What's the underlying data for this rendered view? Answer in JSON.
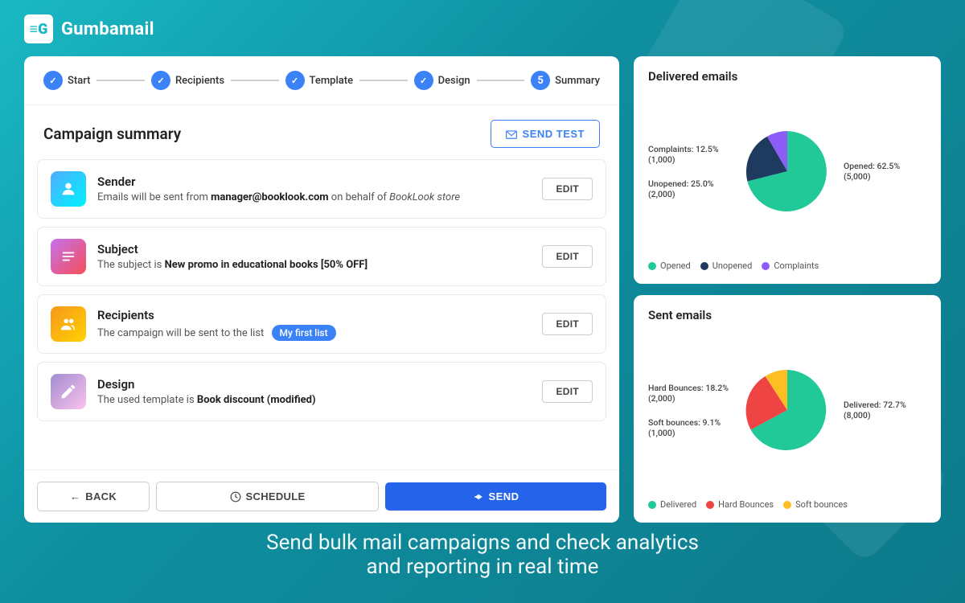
{
  "app": {
    "logo_text": "Gumbamail",
    "logo_icon": "≡G"
  },
  "tagline": {
    "line1": "Send bulk mail campaigns and check analytics",
    "line2": "and reporting in real time"
  },
  "stepper": {
    "steps": [
      {
        "id": "start",
        "label": "Start",
        "type": "check"
      },
      {
        "id": "recipients",
        "label": "Recipients",
        "type": "check"
      },
      {
        "id": "template",
        "label": "Template",
        "type": "check"
      },
      {
        "id": "design",
        "label": "Design",
        "type": "check"
      },
      {
        "id": "summary",
        "label": "Summary",
        "type": "number",
        "number": "5",
        "active": true
      }
    ]
  },
  "campaign": {
    "title": "Campaign summary",
    "send_test_label": "SEND TEST",
    "items": [
      {
        "id": "sender",
        "icon_type": "sender",
        "title": "Sender",
        "description_html": "Emails will be sent from <strong>manager@booklook.com</strong> on behalf of <em>BookLook store</em>",
        "edit_label": "EDIT"
      },
      {
        "id": "subject",
        "icon_type": "subject",
        "title": "Subject",
        "description_html": "The subject is <strong>New promo in educational books [50% OFF]</strong>",
        "edit_label": "EDIT"
      },
      {
        "id": "recipients",
        "icon_type": "recipients",
        "title": "Recipients",
        "description_text": "The campaign will be sent to the list",
        "badge": "My first list",
        "edit_label": "EDIT"
      },
      {
        "id": "design",
        "icon_type": "design",
        "title": "Design",
        "description_html": "The used template is <strong>Book discount (modified)</strong>",
        "edit_label": "EDIT"
      }
    ]
  },
  "footer": {
    "back_label": "BACK",
    "schedule_label": "SCHEDULE",
    "send_label": "SEND"
  },
  "delivered_chart": {
    "title": "Delivered emails",
    "segments": [
      {
        "label": "Opened",
        "value": 62.5,
        "count": "5,000",
        "color": "#20c997"
      },
      {
        "label": "Unopened",
        "value": 25.0,
        "count": "2,000",
        "color": "#1e3a5f"
      },
      {
        "label": "Complaints",
        "value": 12.5,
        "count": "1,000",
        "color": "#8b5cf6"
      }
    ],
    "labels": {
      "complaints": "Complaints: 12.5% (1,000)",
      "unopened": "Unopened: 25.0% (2,000)",
      "opened": "Opened: 62.5% (5,000)"
    }
  },
  "sent_chart": {
    "title": "Sent emails",
    "segments": [
      {
        "label": "Delivered",
        "value": 72.7,
        "count": "8,000",
        "color": "#20c997"
      },
      {
        "label": "Hard Bounces",
        "value": 18.2,
        "count": "2,000",
        "color": "#ef4444"
      },
      {
        "label": "Soft bounces",
        "value": 9.1,
        "count": "1,000",
        "color": "#fbbf24"
      }
    ],
    "labels": {
      "hard_bounces": "Hard Bounces: 18.2% (2,000)",
      "soft_bounces": "Soft bounces: 9.1% (1,000)",
      "delivered": "Delivered: 72.7% (8,000)"
    }
  }
}
